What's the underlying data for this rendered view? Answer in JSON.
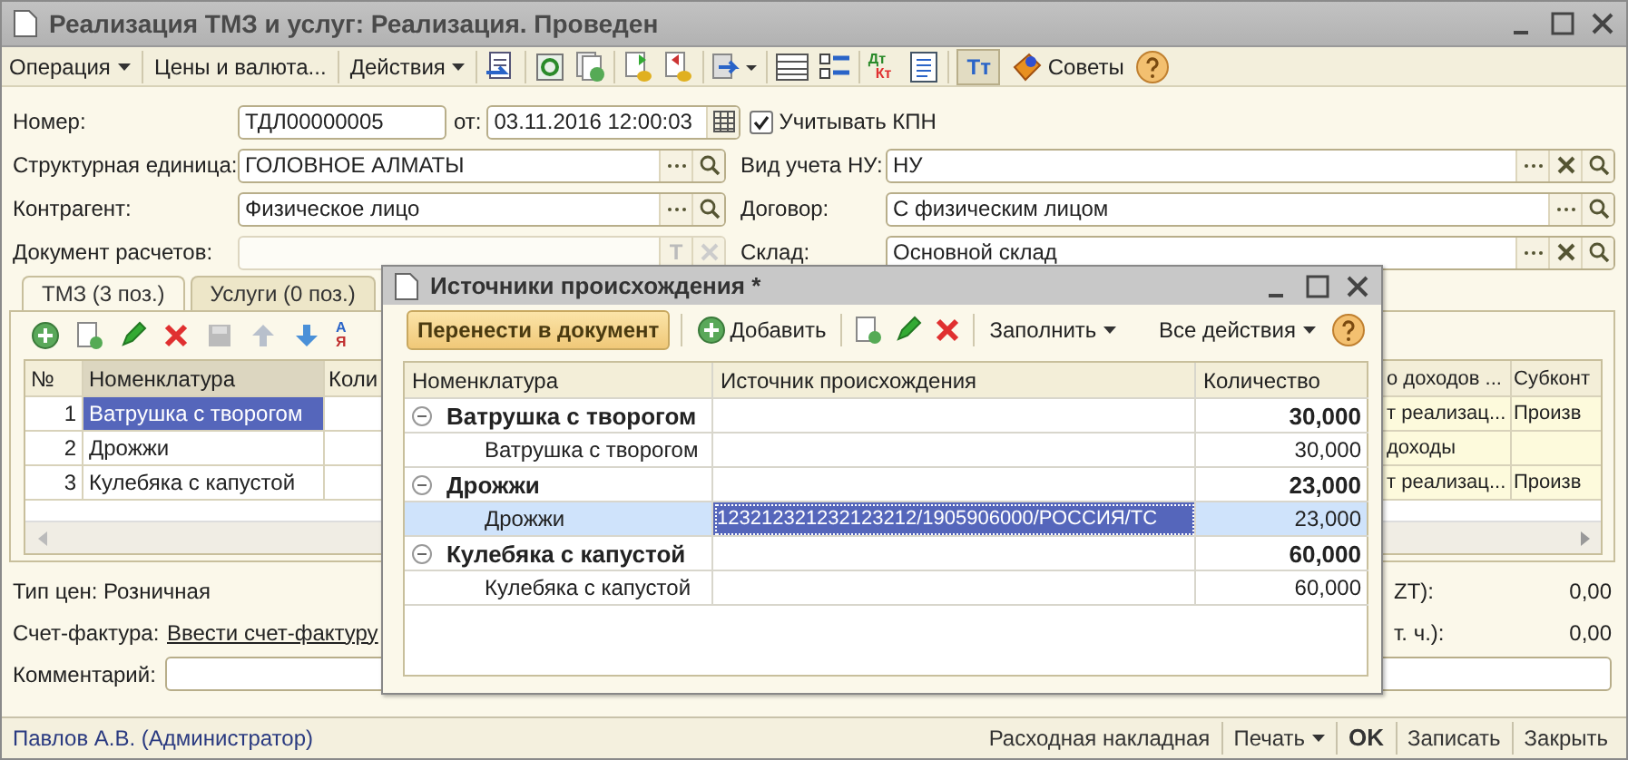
{
  "window": {
    "title": "Реализация ТМЗ и услуг: Реализация. Проведен"
  },
  "toolbar": {
    "menus": [
      {
        "label": "Операция",
        "kind": "menu"
      },
      {
        "label": "Цены и валюта...",
        "kind": "button"
      },
      {
        "label": "Действия",
        "kind": "menu"
      }
    ],
    "ledger_icon": {
      "top": "Дт",
      "bottom": "Кт"
    },
    "format_toggle": {
      "label": "Тт",
      "pressed": true
    },
    "tips": "Советы"
  },
  "form": {
    "number": {
      "label": "Номер:",
      "value": "ТДЛ00000005"
    },
    "date": {
      "label": "от:",
      "value": "03.11.2016 12:00:03"
    },
    "kpn": {
      "label": "Учитывать КПН",
      "checked": true
    },
    "unit": {
      "label": "Структурная единица:",
      "value": "ГОЛОВНОЕ АЛМАТЫ",
      "clearable": false
    },
    "tax_accounting": {
      "label": "Вид учета НУ:",
      "value": "НУ",
      "clearable": true
    },
    "counterparty": {
      "label": "Контрагент:",
      "value": "Физическое лицо",
      "clearable": false
    },
    "contract": {
      "label": "Договор:",
      "value": "С физическим лицом",
      "clearable": false
    },
    "settlement_doc": {
      "label": "Документ расчетов:",
      "type_button": "T",
      "disabled": true
    },
    "warehouse": {
      "label": "Склад:",
      "value": "Основной склад",
      "clearable": true
    }
  },
  "tabs": [
    {
      "label": "ТМЗ (3 поз.)",
      "selected": true
    },
    {
      "label": "Услуги (0 поз.)",
      "selected": false
    }
  ],
  "goods_toolbar": {
    "sort": {
      "top": "А",
      "bottom": "Я"
    }
  },
  "goods_table": {
    "columns": [
      "№",
      "Номенклатура",
      "Коли",
      "о доходов ...",
      "Субконт"
    ],
    "rows": [
      {
        "n": "1",
        "item": "Ватрушка с творогом",
        "col_4": "т реализац...",
        "col_5": "Произв",
        "selected": true
      },
      {
        "n": "2",
        "item": "Дрожжи",
        "col_4": "доходы",
        "selected": false
      },
      {
        "n": "3",
        "item": "Кулебяка с капустой",
        "col_4": "т реализац...",
        "col_5": "Произв",
        "selected": false
      }
    ]
  },
  "price_type": "Тип цен: Розничная",
  "invoice": {
    "label": "Счет-фактура:",
    "link": "Ввести счет-фактуру"
  },
  "comment": {
    "label": "Комментарий:"
  },
  "totals": [
    {
      "label": "ZT):",
      "value": "0,00"
    },
    {
      "label": "т. ч.):",
      "value": "0,00"
    }
  ],
  "status_bar": {
    "user": "Павлов А.В. (Администратор)",
    "buttons": [
      {
        "label": "Расходная накладная",
        "kind": "plain"
      },
      {
        "label": "Печать",
        "kind": "menu"
      },
      {
        "label": "OK",
        "kind": "default"
      },
      {
        "label": "Записать",
        "kind": "plain"
      },
      {
        "label": "Закрыть",
        "kind": "plain"
      }
    ]
  },
  "dialog": {
    "title": "Источники происхождения *",
    "primary": "Перенести в документ",
    "add": "Добавить",
    "fill": "Заполнить",
    "all_actions": "Все действия",
    "columns": [
      "Номенклатура",
      "Источник происхождения",
      "Количество"
    ],
    "rows": [
      {
        "name": "Ватрушка с творогом",
        "qty": "30,000",
        "expanded": true,
        "children": [
          {
            "name": "Ватрушка с творогом",
            "qty": "30,000",
            "selected": false
          }
        ]
      },
      {
        "name": "Дрожжи",
        "qty": "23,000",
        "expanded": true,
        "children": [
          {
            "name": "Дрожжи",
            "source": "123212321232123212/1905906000/РОССИЯ/ТС",
            "qty": "23,000",
            "selected": true
          }
        ]
      },
      {
        "name": "Кулебяка с капустой",
        "qty": "60,000",
        "expanded": true,
        "children": [
          {
            "name": "Кулебяка с капустой",
            "qty": "60,000",
            "selected": false
          }
        ]
      }
    ]
  }
}
